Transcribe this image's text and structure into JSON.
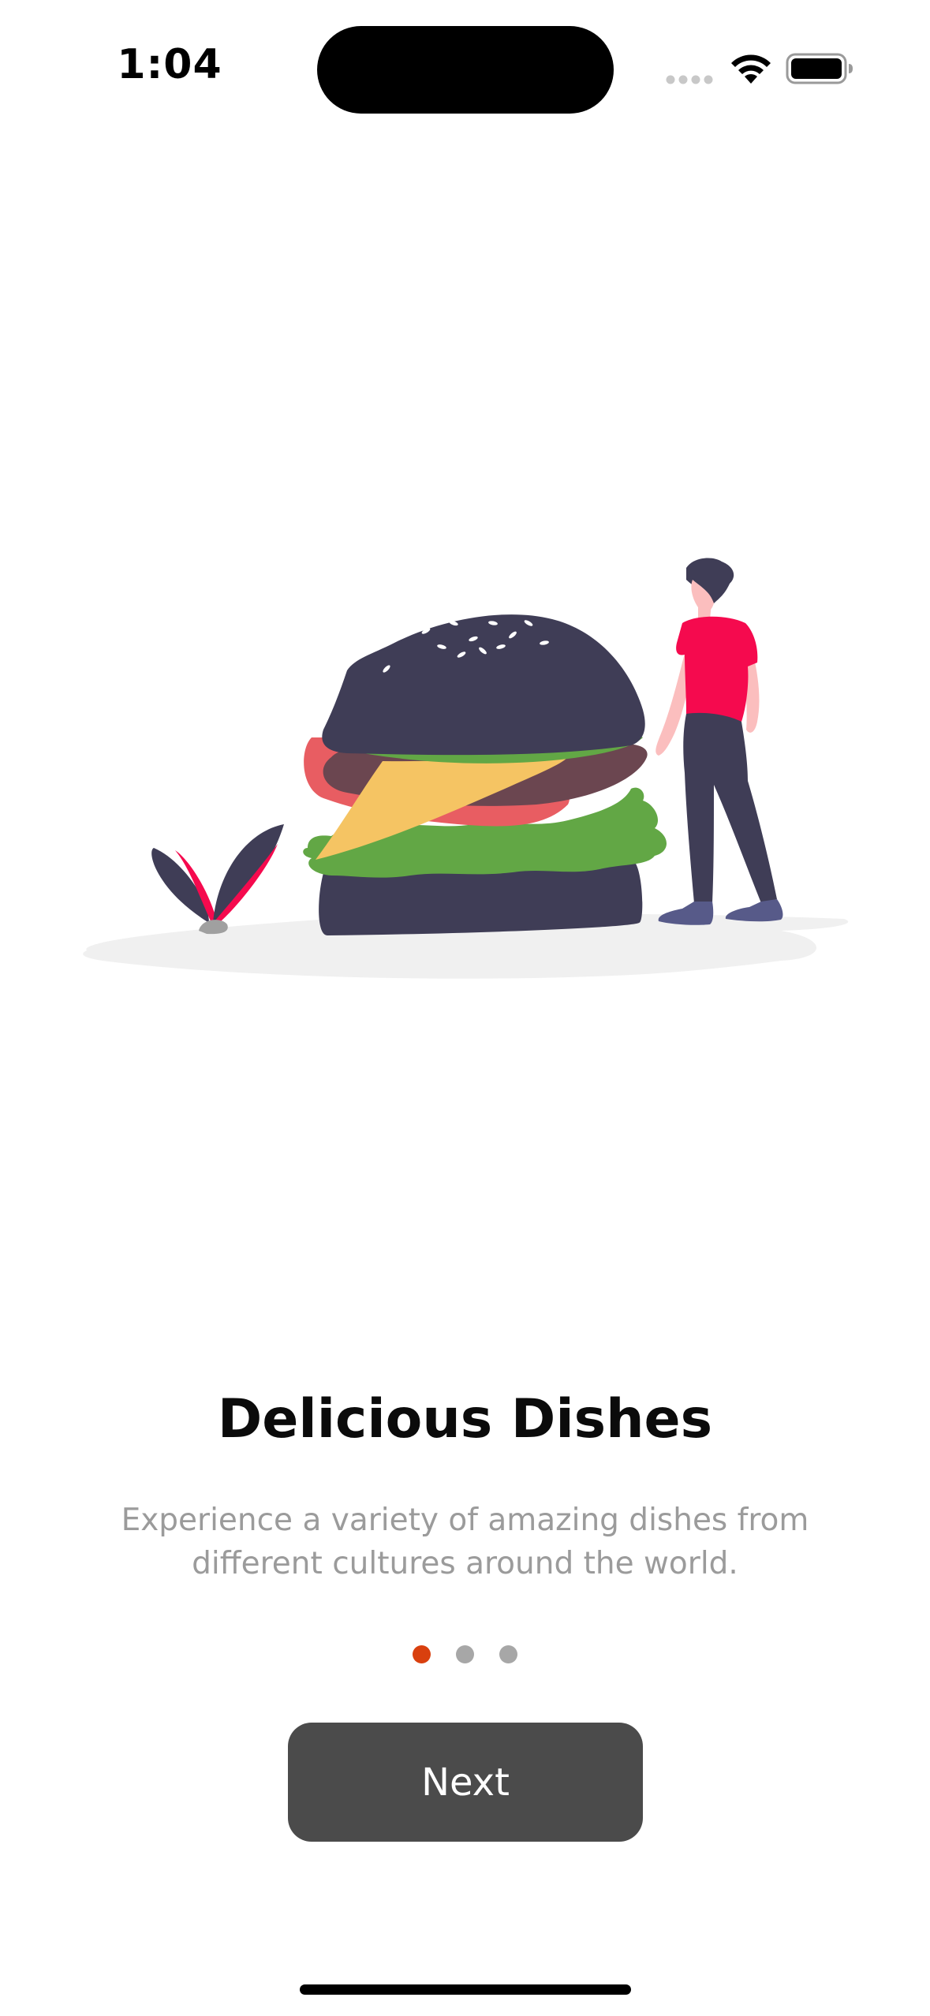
{
  "status_bar": {
    "time": "1:04",
    "signal_icon": "cellular-signal-icon",
    "wifi_icon": "wifi-icon",
    "battery_icon": "battery-icon"
  },
  "illustration": {
    "subject": "burger-person-illustration",
    "colors": {
      "bun": "#3f3d56",
      "tomato": "#e85d62",
      "lettuce": "#62a745",
      "cheese": "#f5c463",
      "patty": "#6b4650",
      "shirt": "#f50a4e",
      "ground": "#f0f0f0"
    }
  },
  "onboarding": {
    "title": "Delicious Dishes",
    "description": "Experience a variety of amazing dishes from different cultures around the world.",
    "page_indicator": {
      "total": 3,
      "current": 1
    },
    "next_label": "Next"
  },
  "colors": {
    "accent_dot": "#d9400e",
    "inactive_dot": "#a7a7a7",
    "button_bg": "#4b4b4b",
    "button_text": "#ffffff",
    "description_text": "#9b9b9b"
  }
}
